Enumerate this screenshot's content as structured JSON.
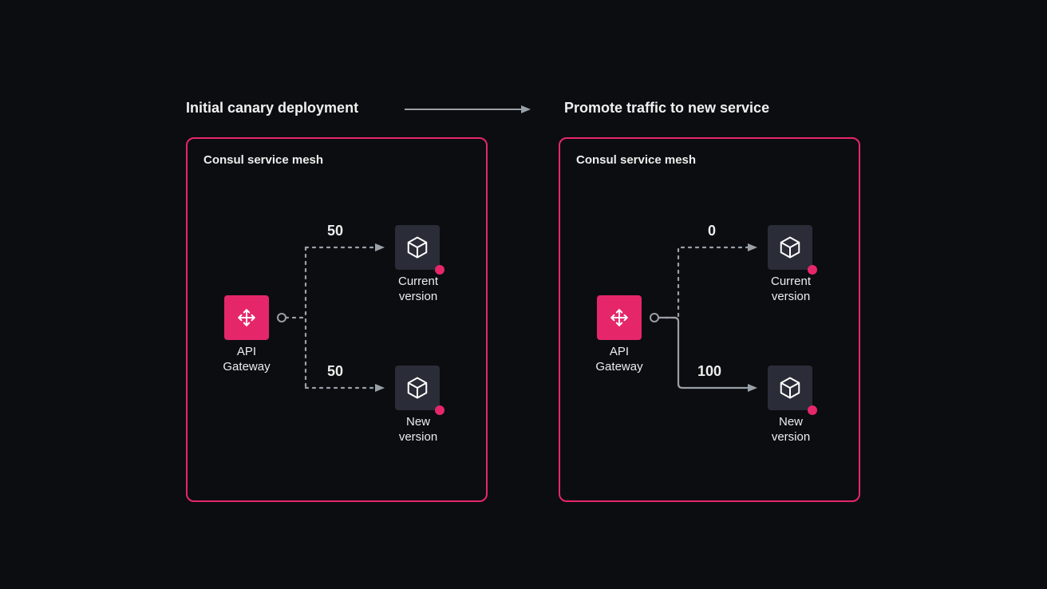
{
  "diagram": {
    "left_title": "Initial canary deployment",
    "right_title": "Promote traffic to new service",
    "panels": [
      {
        "title": "Consul service mesh",
        "gateway_label": "API\nGateway",
        "top_weight": "50",
        "bottom_weight": "50",
        "top_service_label": "Current\nversion",
        "bottom_service_label": "New\nversion",
        "top_solid": false,
        "bottom_solid": false
      },
      {
        "title": "Consul service mesh",
        "gateway_label": "API\nGateway",
        "top_weight": "0",
        "bottom_weight": "100",
        "top_service_label": "Current\nversion",
        "bottom_service_label": "New\nversion",
        "top_solid": false,
        "bottom_solid": true
      }
    ]
  },
  "colors": {
    "accent": "#e5276a",
    "bg": "#0c0d11",
    "node": "#2a2d37",
    "line": "#9aa0a8"
  }
}
